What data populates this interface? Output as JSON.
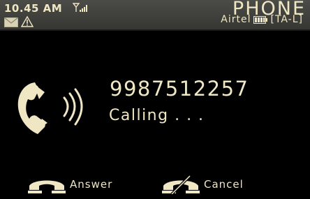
{
  "status_bar": {
    "time": "10.45 AM",
    "signal_icon": "signal-bars-icon",
    "app_title": "PHONE",
    "notifications": [
      "mail-icon",
      "warning-icon"
    ],
    "carrier": "Airtel",
    "battery_icon": "battery-icon",
    "sim_label": "[TA-L]"
  },
  "call": {
    "phone_icon": "ringing-handset-icon",
    "number": "9987512257",
    "status": "Calling . . ."
  },
  "softkeys": {
    "answer_label": "Answer",
    "answer_icon": "answer-handset-icon",
    "cancel_label": "Cancel",
    "cancel_icon": "cancel-handset-icon"
  },
  "colors": {
    "text": "#efe6c4",
    "background": "#000000",
    "status_bar": "#3f3f3b"
  }
}
